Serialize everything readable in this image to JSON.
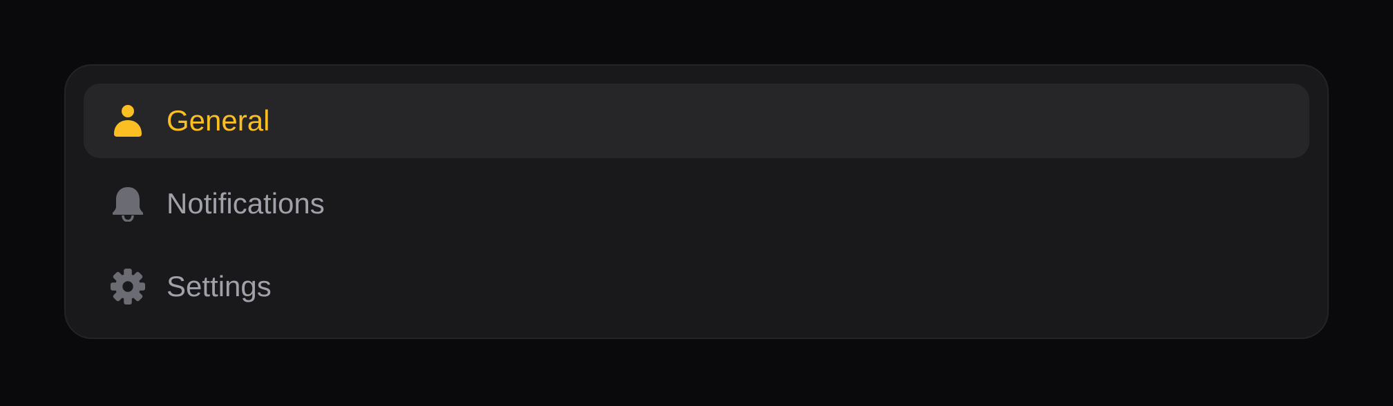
{
  "menu": {
    "items": [
      {
        "label": "General",
        "icon": "user-icon",
        "active": true
      },
      {
        "label": "Notifications",
        "icon": "bell-icon",
        "active": false
      },
      {
        "label": "Settings",
        "icon": "gear-icon",
        "active": false
      }
    ]
  },
  "colors": {
    "page_background": "#0a0a0c",
    "panel_background": "#19191b",
    "active_item_background": "#262628",
    "accent": "#fbbf24",
    "inactive_text": "#a1a1aa",
    "inactive_icon": "#6b6b73"
  }
}
